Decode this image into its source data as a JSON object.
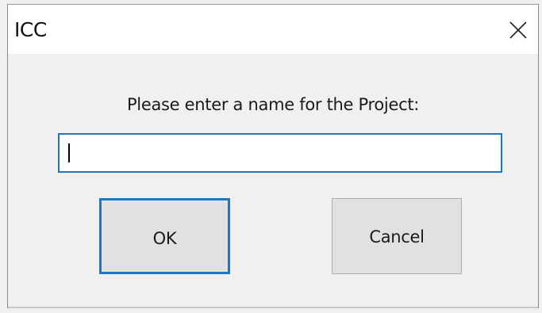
{
  "window": {
    "title": "ICC",
    "close_icon": "close-icon"
  },
  "dialog": {
    "prompt": "Please enter a name for the Project:",
    "name_input": {
      "value": "",
      "placeholder": ""
    },
    "ok_label": "OK",
    "cancel_label": "Cancel"
  },
  "colors": {
    "accent": "#1d77c5",
    "button_face": "#e1e1e1",
    "dialog_bg": "#f0f0f0"
  }
}
